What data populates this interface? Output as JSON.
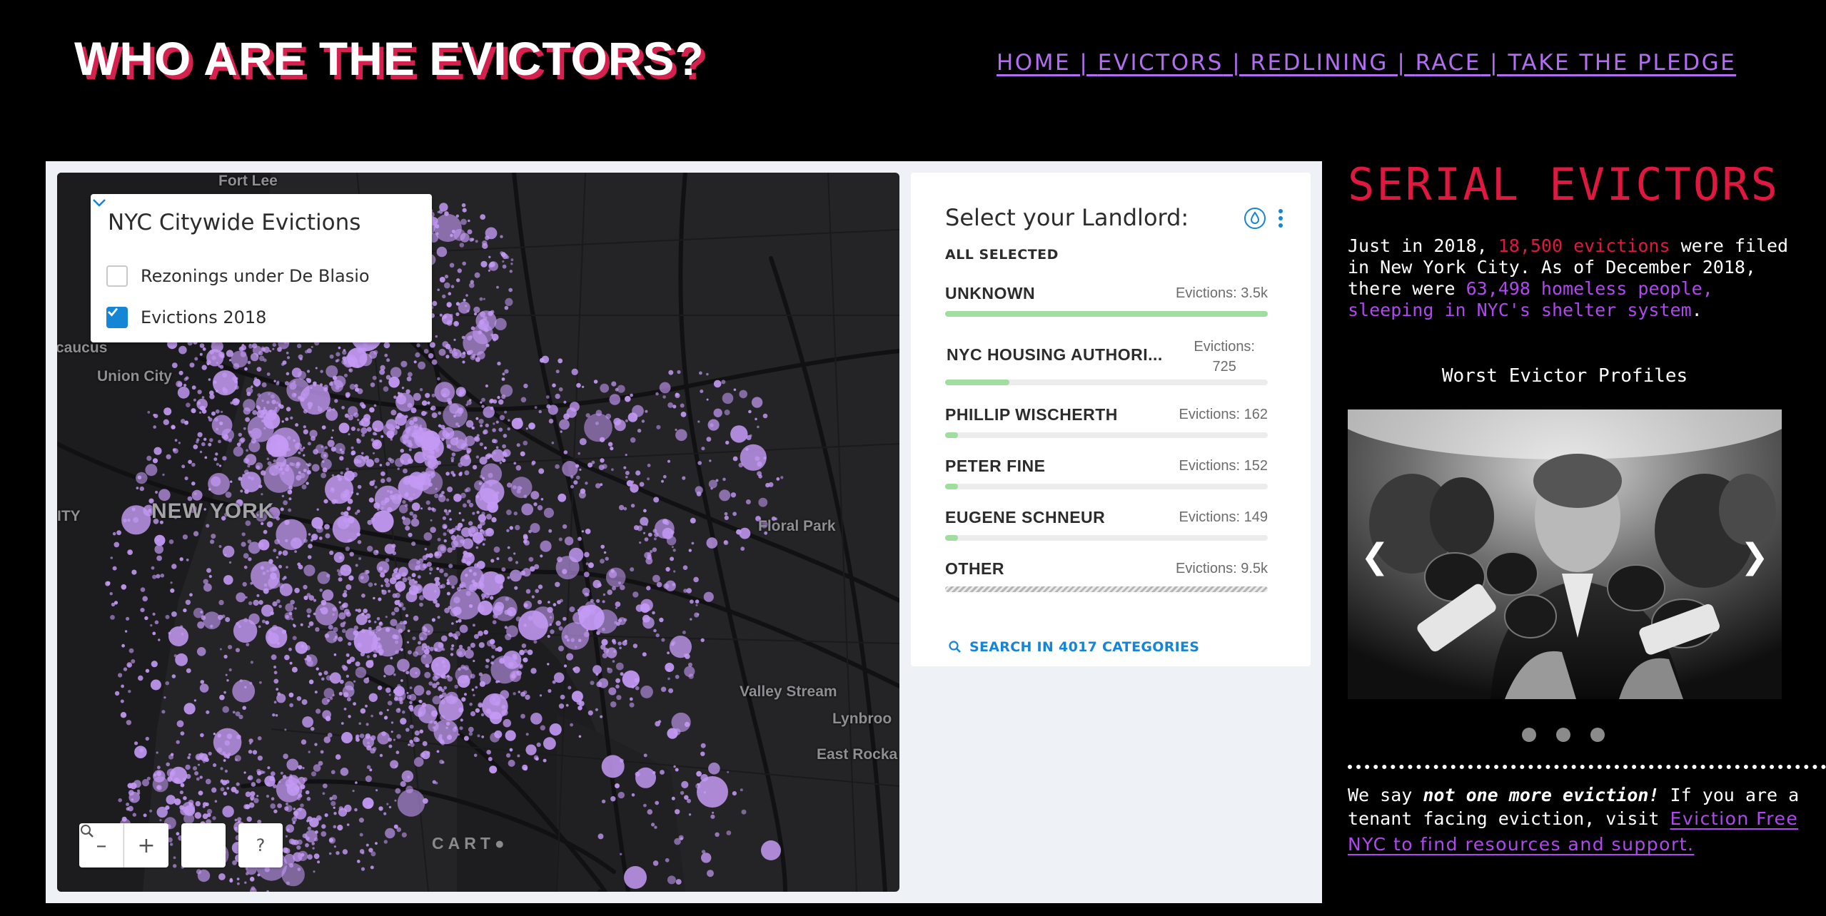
{
  "header": {
    "title": "WHO ARE THE EVICTORS?",
    "nav": [
      "HOME",
      "EVICTORS",
      "REDLINING",
      "RACE",
      "TAKE THE PLEDGE"
    ],
    "nav_sep": " | "
  },
  "map": {
    "layers_title": "NYC Citywide Evictions",
    "layers": [
      {
        "label": "Rezonings under De Blasio",
        "checked": false
      },
      {
        "label": "Evictions 2018",
        "checked": true
      }
    ],
    "place_labels": [
      "Fort Lee",
      "caucus",
      "Union City",
      "NEW YORK",
      "ITY",
      "Floral Park",
      "Valley Stream",
      "Lynbroo",
      "East Rocka"
    ],
    "controls": {
      "zoom_out": "–",
      "zoom_in": "+",
      "help": "?"
    },
    "attribution": "CART●",
    "colors": {
      "background": "#242426",
      "road": "#121214",
      "bubble": "#c49af5"
    }
  },
  "widget": {
    "title": "Select your Landlord:",
    "all_selected": "ALL SELECTED",
    "categories": [
      {
        "name": "UNKNOWN",
        "count": "Evictions: 3.5k",
        "fraction": 1.0
      },
      {
        "name": "NYC HOUSING AUTHORI...",
        "count_line1": "Evictions:",
        "count_line2": "725",
        "fraction": 0.2
      },
      {
        "name": "PHILLIP WISCHERTH",
        "count": "Evictions: 162",
        "fraction": 0.04
      },
      {
        "name": "PETER FINE",
        "count": "Evictions: 152",
        "fraction": 0.04
      },
      {
        "name": "EUGENE SCHNEUR",
        "count": "Evictions: 149",
        "fraction": 0.04
      },
      {
        "name": "OTHER",
        "count": "Evictions: 9.5k",
        "fraction": 1.0
      }
    ],
    "search_label": "SEARCH IN 4017 CATEGORIES",
    "bar_color": "#a0dea0"
  },
  "sidebar": {
    "title": "SERIAL EVICTORS",
    "intro_1": "Just in 2018, ",
    "intro_red": "18,500 evictions",
    "intro_2": " were filed in New York City. As of December 2018, there were ",
    "intro_purple": "63,498 homeless people, sleeping in NYC's shelter system",
    "intro_3": ".",
    "profiles_title": "Worst Evictor Profiles",
    "carousel_prev": "❮",
    "carousel_next": "❯",
    "carousel_dots": 3,
    "pledge_1": "We say ",
    "pledge_em": "not one more eviction!",
    "pledge_2": " If you are a tenant facing eviction, visit ",
    "pledge_link": "Eviction Free NYC to find resources and support.",
    "accent_red": "#e0173f",
    "accent_purple": "#b048f0"
  }
}
